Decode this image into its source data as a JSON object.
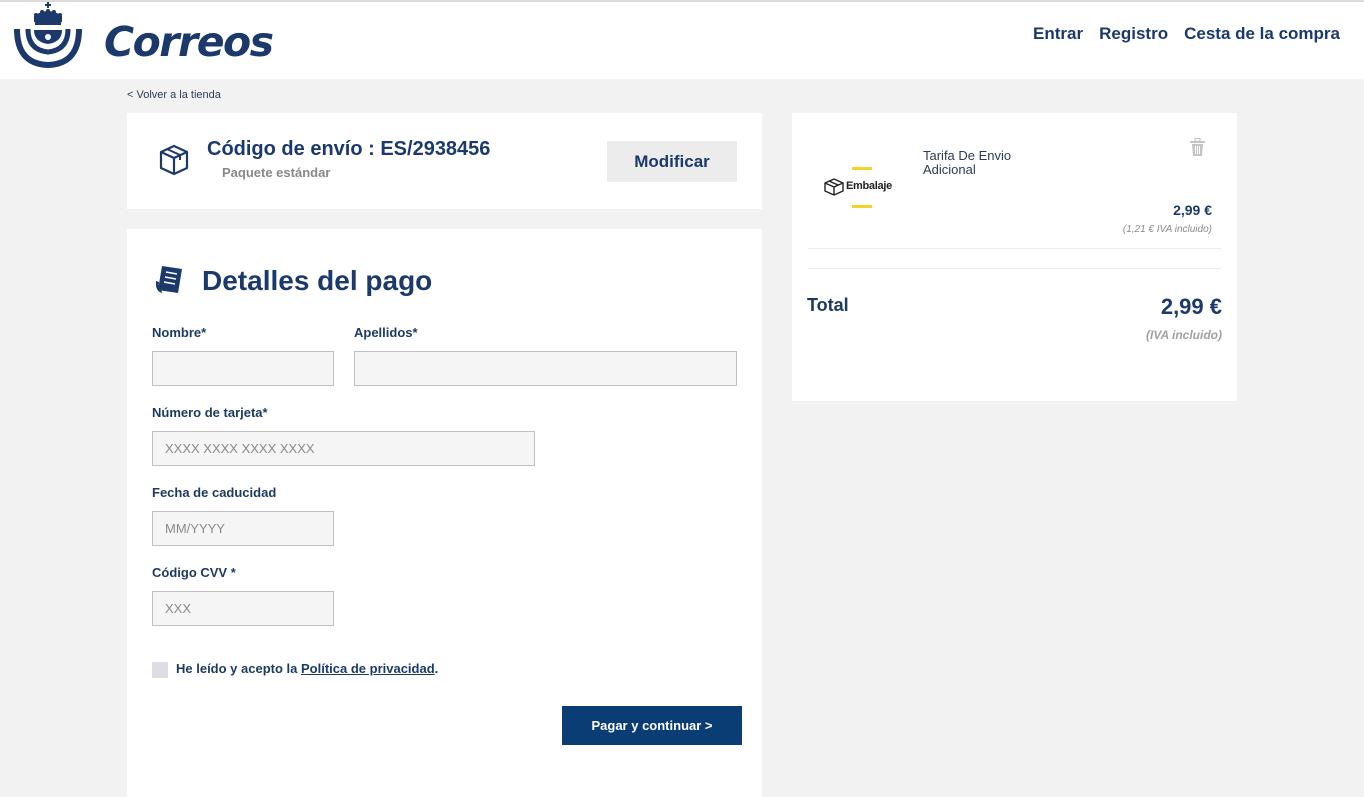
{
  "brand": {
    "name": "Correos"
  },
  "nav": {
    "login": "Entrar",
    "register": "Registro",
    "cart": "Cesta de la compra"
  },
  "back_link": "< Volver a la tienda",
  "shipping": {
    "title": "Código de envío : ES/2938456",
    "subtitle": "Paquete estándar",
    "modify_button": "Modificar"
  },
  "payment": {
    "title": "Detalles del pago",
    "fields": {
      "first_name": {
        "label": "Nombre*",
        "value": "",
        "placeholder": ""
      },
      "last_name": {
        "label": "Apellidos*",
        "value": "",
        "placeholder": ""
      },
      "card_number": {
        "label": "Número de tarjeta*",
        "value": "",
        "placeholder": "XXXX XXXX XXXX XXXX"
      },
      "expiry": {
        "label": "Fecha de caducidad",
        "value": "",
        "placeholder": "MM/YYYY"
      },
      "cvv": {
        "label": "Código CVV *",
        "value": "",
        "placeholder": "XXX"
      }
    },
    "privacy": {
      "prefix": "He leído y acepto la ",
      "link": "Política de privacidad",
      "suffix": ".",
      "checked": false
    },
    "submit_button": "Pagar y continuar >"
  },
  "summary": {
    "item": {
      "logo_text": "Embalaje",
      "name": "Tarifa De Envio Adicional",
      "price": "2,99 €",
      "iva_note": "(1,21 € IVA incluido)"
    },
    "total_label": "Total",
    "total_value": "2,99 €",
    "total_iva": "(IVA incluido)"
  },
  "colors": {
    "brand_navy": "#1b3a6b",
    "button_primary": "#0a3d73",
    "accent_yellow": "#f5d12a",
    "background": "#f2f2f2"
  },
  "icons": [
    "correos-crown-logo-icon",
    "package-box-icon",
    "receipt-icon",
    "trash-icon",
    "embalaje-box-icon"
  ]
}
